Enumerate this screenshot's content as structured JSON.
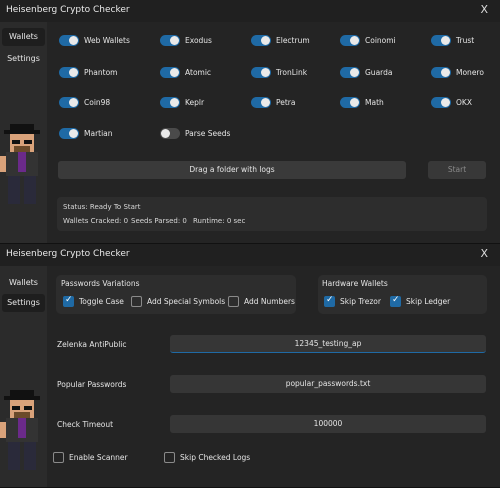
{
  "window1": {
    "title": "Heisenberg Crypto Checker",
    "close": "X",
    "sidebar": {
      "wallets": "Wallets",
      "settings": "Settings"
    },
    "toggles": [
      {
        "label": "Web Wallets",
        "on": true
      },
      {
        "label": "Exodus",
        "on": true
      },
      {
        "label": "Electrum",
        "on": true
      },
      {
        "label": "Coinomi",
        "on": true
      },
      {
        "label": "Trust",
        "on": true
      },
      {
        "label": "Phantom",
        "on": true
      },
      {
        "label": "Atomic",
        "on": true
      },
      {
        "label": "TronLink",
        "on": true
      },
      {
        "label": "Guarda",
        "on": true
      },
      {
        "label": "Monero",
        "on": true
      },
      {
        "label": "Coin98",
        "on": true
      },
      {
        "label": "Keplr",
        "on": true
      },
      {
        "label": "Petra",
        "on": true
      },
      {
        "label": "Math",
        "on": true
      },
      {
        "label": "OKX",
        "on": true
      },
      {
        "label": "Martian",
        "on": true
      },
      {
        "label": "Parse Seeds",
        "on": false
      }
    ],
    "drag_button": "Drag a folder with logs",
    "start_button": "Start",
    "status": {
      "status_text": "Status: Ready To Start",
      "wallets_cracked": "Wallets Cracked: 0",
      "seeds_parsed": "Seeds Parsed: 0",
      "runtime": "Runtime: 0 sec"
    }
  },
  "window2": {
    "title": "Heisenberg Crypto Checker",
    "close": "X",
    "sidebar": {
      "wallets": "Wallets",
      "settings": "Settings"
    },
    "passwords_variations": {
      "title": "Passwords Variations",
      "options": [
        {
          "label": "Toggle Case",
          "checked": true
        },
        {
          "label": "Add Special Symbols",
          "checked": false
        },
        {
          "label": "Add Numbers",
          "checked": false
        }
      ]
    },
    "hardware_wallets": {
      "title": "Hardware Wallets",
      "options": [
        {
          "label": "Skip Trezor",
          "checked": true
        },
        {
          "label": "Skip Ledger",
          "checked": true
        }
      ]
    },
    "fields": [
      {
        "label": "Zelenka AntiPublic",
        "value": "12345_testing_ap"
      },
      {
        "label": "Popular Passwords",
        "value": "popular_passwords.txt"
      },
      {
        "label": "Check Timeout",
        "value": "100000"
      }
    ],
    "bottom_checks": [
      {
        "label": "Enable Scanner",
        "checked": false
      },
      {
        "label": "Skip Checked Logs",
        "checked": false
      }
    ]
  },
  "colors": {
    "accent": "#1f6aa5",
    "background": "#242424",
    "sidebar": "#2b2b2b"
  },
  "icons": {
    "close": "close-icon",
    "checkmark": "check-icon",
    "mascot": "pixel-heisenberg-avatar"
  }
}
